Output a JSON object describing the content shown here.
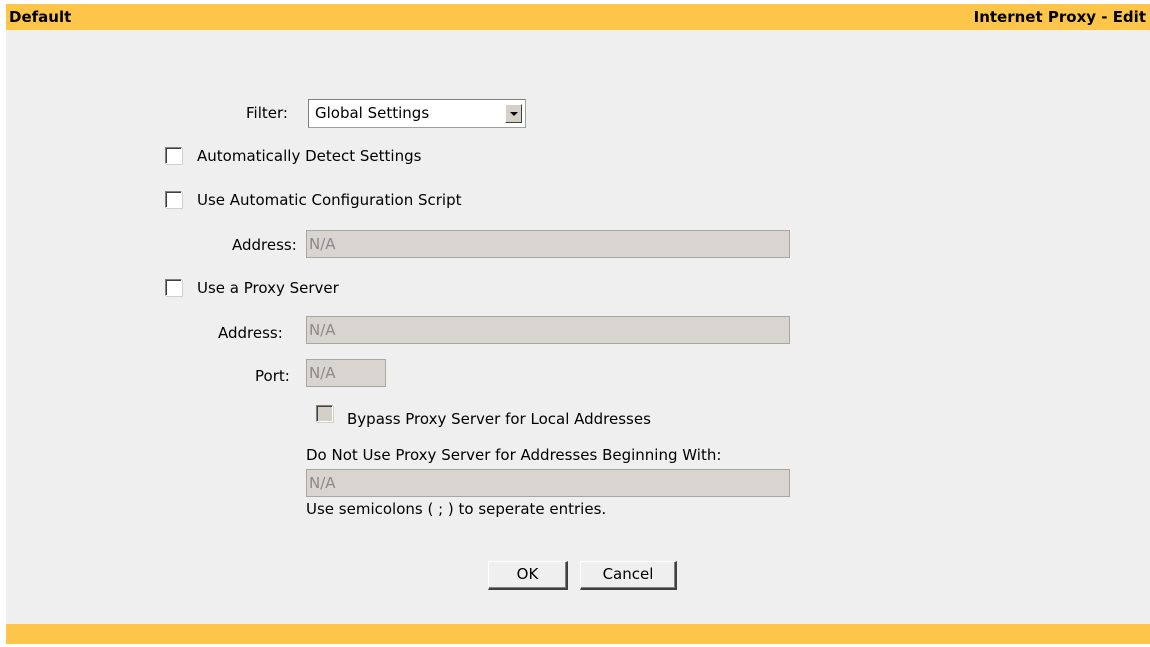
{
  "header": {
    "left_title": "Default",
    "right_title": "Internet Proxy - Edit"
  },
  "filter": {
    "label": "Filter:",
    "selected": "Global Settings"
  },
  "auto_detect": {
    "label": "Automatically Detect Settings",
    "checked": false
  },
  "auto_config": {
    "label": "Use Automatic Configuration Script",
    "checked": false,
    "address_label": "Address:",
    "address_value": "N/A"
  },
  "proxy": {
    "label": "Use a Proxy Server",
    "checked": false,
    "address_label": "Address:",
    "address_value": "N/A",
    "port_label": "Port:",
    "port_value": "N/A",
    "bypass_label": "Bypass Proxy Server for Local Addresses",
    "bypass_checked": false,
    "exceptions_label": "Do Not Use Proxy Server for Addresses Beginning With:",
    "exceptions_value": "N/A",
    "exceptions_hint": "Use semicolons ( ; ) to seperate entries."
  },
  "buttons": {
    "ok": "OK",
    "cancel": "Cancel"
  },
  "colors": {
    "header_bar": "#fdc54a",
    "panel_bg": "#efefef",
    "disabled_field": "#d8d4d0"
  }
}
